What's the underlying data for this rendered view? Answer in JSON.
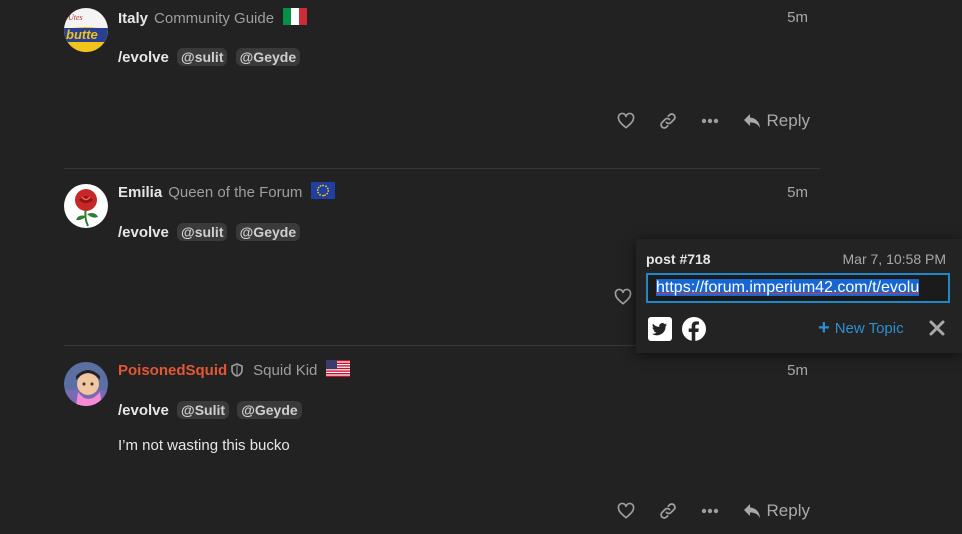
{
  "posts": [
    {
      "username": "Italy",
      "user_title": "Community Guide",
      "time": "5m",
      "command": "/evolve",
      "mentions": [
        "@sulit",
        "@Geyde"
      ],
      "reply_label": "Reply"
    },
    {
      "username": "Emilia",
      "user_title": "Queen of the Forum",
      "time": "5m",
      "command": "/evolve",
      "mentions": [
        "@sulit",
        "@Geyde"
      ]
    },
    {
      "username": "PoisonedSquid",
      "user_title": "Squid Kid",
      "time": "5m",
      "command": "/evolve",
      "mentions": [
        "@Sulit",
        "@Geyde"
      ],
      "body": "I’m not wasting this bucko",
      "reply_label": "Reply"
    }
  ],
  "share_popup": {
    "title": "post #718",
    "date": "Mar 7, 10:58 PM",
    "link": "https://forum.imperium42.com/t/evolu",
    "new_topic_label": "New Topic"
  },
  "avatars": {
    "italy_text": "butte",
    "italy_text_top": "Utes"
  },
  "colors": {
    "background": "#222222",
    "username_red": "#e45735",
    "accent_blue": "#2c8fd1"
  },
  "icons": [
    "heart-icon",
    "link-icon",
    "ellipsis-icon",
    "reply-icon",
    "shield-icon",
    "twitter-icon",
    "facebook-icon",
    "close-icon"
  ]
}
